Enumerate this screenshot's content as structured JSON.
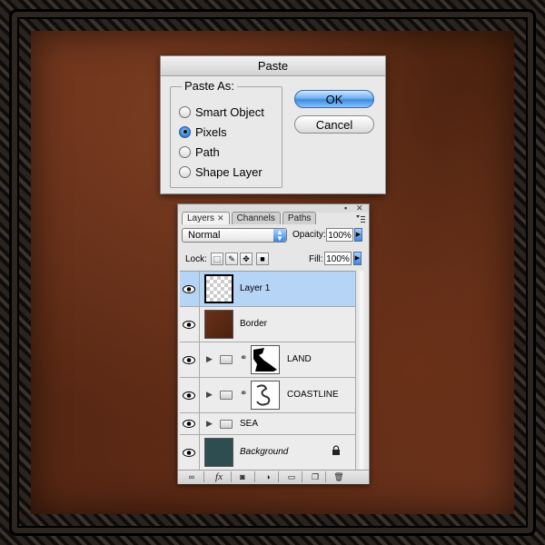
{
  "dialog": {
    "title": "Paste",
    "group_label": "Paste As:",
    "options": [
      {
        "label": "Smart Object",
        "selected": false
      },
      {
        "label": "Pixels",
        "selected": true
      },
      {
        "label": "Path",
        "selected": false
      },
      {
        "label": "Shape Layer",
        "selected": false
      }
    ],
    "ok_label": "OK",
    "cancel_label": "Cancel"
  },
  "layers_panel": {
    "tabs": [
      "Layers",
      "Channels",
      "Paths"
    ],
    "active_tab": "Layers",
    "blend_mode": "Normal",
    "opacity_label": "Opacity:",
    "opacity_value": "100%",
    "lock_label": "Lock:",
    "fill_label": "Fill:",
    "fill_value": "100%",
    "layers": [
      {
        "name": "Layer 1",
        "selected": true,
        "visible": true,
        "type": "pixel"
      },
      {
        "name": "Border",
        "selected": false,
        "visible": true,
        "type": "pixel"
      },
      {
        "name": "LAND",
        "selected": false,
        "visible": true,
        "type": "group-masked"
      },
      {
        "name": "COASTLINE",
        "selected": false,
        "visible": true,
        "type": "group-masked"
      },
      {
        "name": "SEA",
        "selected": false,
        "visible": true,
        "type": "group"
      },
      {
        "name": "Background",
        "selected": false,
        "visible": true,
        "type": "background",
        "locked": true
      }
    ],
    "bottom_icons": [
      "link-icon",
      "fx-icon",
      "mask-icon",
      "adjustment-icon",
      "new-group-icon",
      "new-layer-icon",
      "trash-icon"
    ],
    "fx_label": "fx"
  },
  "colors": {
    "selection": "#b6d4f5",
    "background_layer_thumb": "#2d4d50",
    "border_thumb": "#5a2a16"
  }
}
